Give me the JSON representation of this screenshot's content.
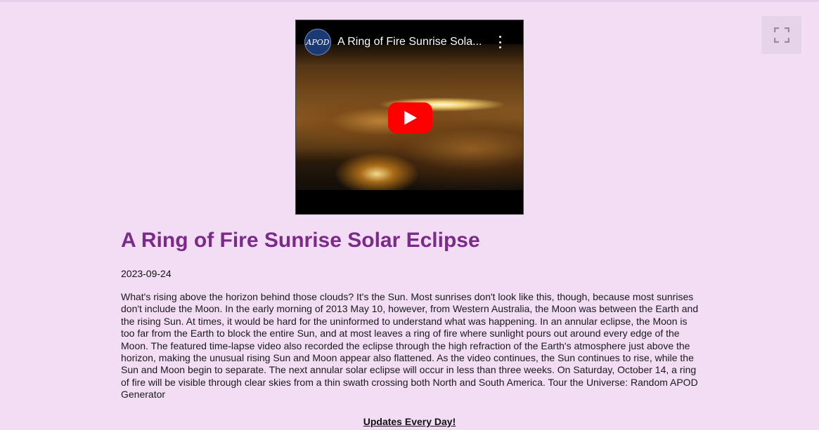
{
  "video": {
    "channel_avatar_text": "APOD",
    "title": "A Ring of Fire Sunrise Sola...",
    "menu_icon": "kebab-menu-icon",
    "play_icon": "play-icon",
    "play_button_color": "#ff0000"
  },
  "fullscreen": {
    "icon": "fullscreen-icon"
  },
  "article": {
    "title": "A Ring of Fire Sunrise Solar Eclipse",
    "date": "2023-09-24",
    "description": "What's rising above the horizon behind those clouds? It's the Sun. Most sunrises don't look like this, though, because most sunrises don't include the Moon. In the early morning of 2013 May 10, however, from Western Australia, the Moon was between the Earth and the rising Sun. At times, it would be hard for the uninformed to understand what was happening. In an annular eclipse, the Moon is too far from the Earth to block the entire Sun, and at most leaves a ring of fire where sunlight pours out around every edge of the Moon. The featured time-lapse video also recorded the eclipse through the high refraction of the Earth's atmosphere just above the horizon, making the unusual rising Sun and Moon appear also flattened. As the video continues, the Sun continues to rise, while the Sun and Moon begin to separate. The next annular solar eclipse will occur in less than three weeks. On Saturday, October 14, a ring of fire will be visible through clear skies from a thin swath crossing both North and South America. Tour the Universe: Random APOD Generator"
  },
  "footer": {
    "updates_link": "Updates Every Day!"
  },
  "colors": {
    "page_background": "#f2ddf5",
    "title_color": "#7b2a8a"
  }
}
